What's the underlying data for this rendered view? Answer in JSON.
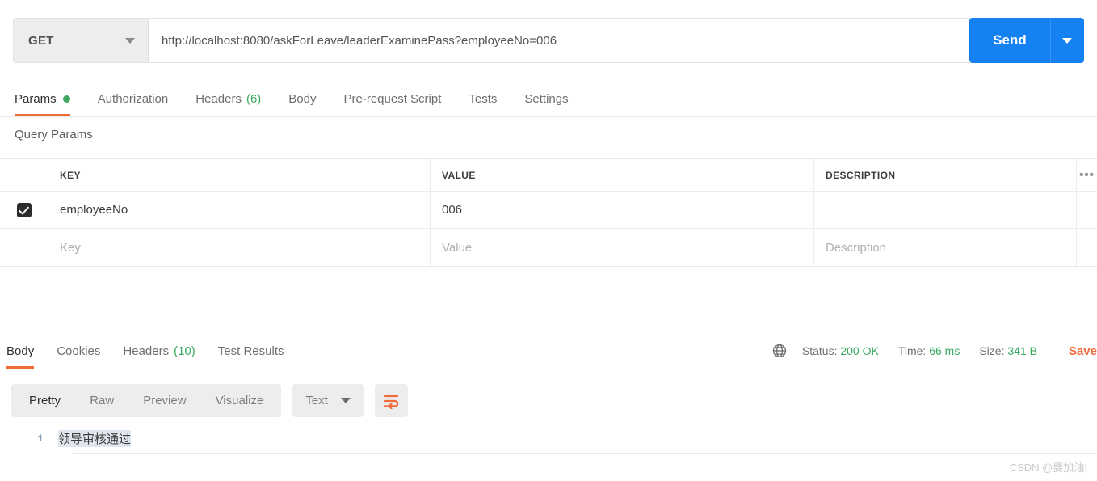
{
  "request": {
    "method": "GET",
    "url": "http://localhost:8080/askForLeave/leaderExaminePass?employeeNo=006",
    "send_label": "Send",
    "tabs": [
      {
        "label": "Params",
        "count": "",
        "dot": true,
        "active": true
      },
      {
        "label": "Authorization",
        "count": "",
        "dot": false,
        "active": false
      },
      {
        "label": "Headers",
        "count": "(6)",
        "dot": false,
        "active": false
      },
      {
        "label": "Body",
        "count": "",
        "dot": false,
        "active": false
      },
      {
        "label": "Pre-request Script",
        "count": "",
        "dot": false,
        "active": false
      },
      {
        "label": "Tests",
        "count": "",
        "dot": false,
        "active": false
      },
      {
        "label": "Settings",
        "count": "",
        "dot": false,
        "active": false
      }
    ]
  },
  "params": {
    "section_title": "Query Params",
    "columns": [
      "KEY",
      "VALUE",
      "DESCRIPTION"
    ],
    "more_glyph": "•••",
    "rows": [
      {
        "checked": true,
        "key": "employeeNo",
        "value": "006",
        "description": ""
      }
    ],
    "empty_row": {
      "key_placeholder": "Key",
      "value_placeholder": "Value",
      "description_placeholder": "Description"
    }
  },
  "response": {
    "tabs": [
      {
        "label": "Body",
        "count": "",
        "active": true
      },
      {
        "label": "Cookies",
        "count": "",
        "active": false
      },
      {
        "label": "Headers",
        "count": "(10)",
        "active": false
      },
      {
        "label": "Test Results",
        "count": "",
        "active": false
      }
    ],
    "status_label": "Status:",
    "status_value": "200 OK",
    "time_label": "Time:",
    "time_value": "66 ms",
    "size_label": "Size:",
    "size_value": "341 B",
    "save_label": "Save",
    "view_modes": [
      {
        "label": "Pretty",
        "active": true
      },
      {
        "label": "Raw",
        "active": false
      },
      {
        "label": "Preview",
        "active": false
      },
      {
        "label": "Visualize",
        "active": false
      }
    ],
    "format": "Text",
    "body_lines": [
      {
        "number": "1",
        "text": "领导审核通过"
      }
    ]
  },
  "watermark": "CSDN @要加油!",
  "colors": {
    "accent_orange": "#F26B3A",
    "send_blue": "#1581F3",
    "status_green": "#3BA75F",
    "checkbox_dark": "#2C2C2C"
  }
}
